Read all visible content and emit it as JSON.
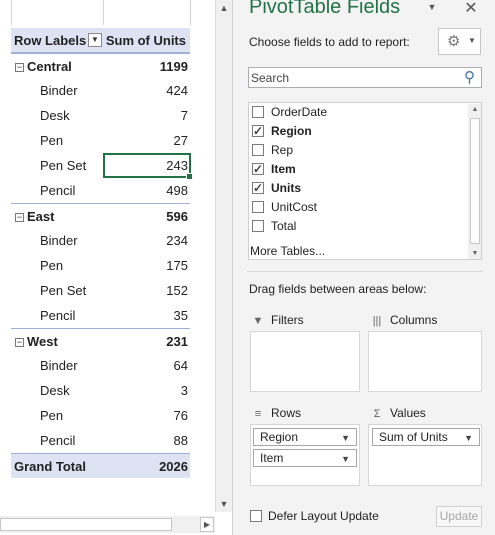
{
  "pivot": {
    "header": {
      "row_labels": "Row Labels",
      "sum_col": "Sum of Units"
    },
    "groups": [
      {
        "name": "Central",
        "total": "1199",
        "items": [
          {
            "label": "Binder",
            "value": "424"
          },
          {
            "label": "Desk",
            "value": "7"
          },
          {
            "label": "Pen",
            "value": "27"
          },
          {
            "label": "Pen Set",
            "value": "243"
          },
          {
            "label": "Pencil",
            "value": "498"
          }
        ]
      },
      {
        "name": "East",
        "total": "596",
        "items": [
          {
            "label": "Binder",
            "value": "234"
          },
          {
            "label": "Pen",
            "value": "175"
          },
          {
            "label": "Pen Set",
            "value": "152"
          },
          {
            "label": "Pencil",
            "value": "35"
          }
        ]
      },
      {
        "name": "West",
        "total": "231",
        "items": [
          {
            "label": "Binder",
            "value": "64"
          },
          {
            "label": "Desk",
            "value": "3"
          },
          {
            "label": "Pen",
            "value": "76"
          },
          {
            "label": "Pencil",
            "value": "88"
          }
        ]
      }
    ],
    "grand_total": {
      "label": "Grand Total",
      "value": "2026"
    },
    "collapse_symbol": "−",
    "filter_symbol": "▼"
  },
  "pane": {
    "title": "PivotTable Fields",
    "dropdown_icon": "▼",
    "close_icon": "✕",
    "choose_label": "Choose fields to add to report:",
    "gear_icon": "⚙",
    "gear_caret": "▼",
    "search_placeholder": "Search",
    "search_icon": "⚲",
    "fields": [
      {
        "name": "OrderDate",
        "checked": false
      },
      {
        "name": "Region",
        "checked": true
      },
      {
        "name": "Rep",
        "checked": false
      },
      {
        "name": "Item",
        "checked": true
      },
      {
        "name": "Units",
        "checked": true
      },
      {
        "name": "UnitCost",
        "checked": false
      },
      {
        "name": "Total",
        "checked": false
      }
    ],
    "more_tables": "More Tables...",
    "drag_label": "Drag fields between areas below:",
    "areas": {
      "filters": {
        "label": "Filters",
        "icon": "▼"
      },
      "columns": {
        "label": "Columns",
        "icon": "|||"
      },
      "rows": {
        "label": "Rows",
        "icon": "≡",
        "chips": [
          "Region",
          "Item"
        ]
      },
      "values": {
        "label": "Values",
        "icon": "Σ",
        "chips": [
          "Sum of Units"
        ]
      }
    },
    "chip_caret": "▼",
    "defer_label": "Defer Layout Update",
    "update_label": "Update"
  },
  "scrollbars": {
    "up": "▲",
    "down": "▼",
    "right": "▶"
  },
  "colors": {
    "accent": "#217346",
    "header_bg": "#dde3f2",
    "pane_bg": "#f3f3f3"
  }
}
